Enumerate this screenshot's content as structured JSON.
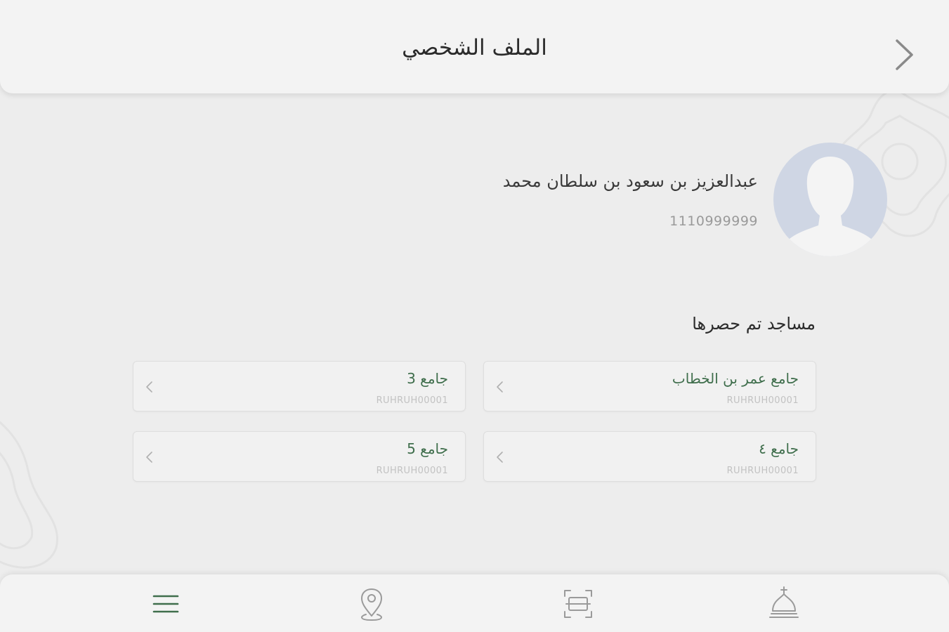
{
  "header": {
    "title": "الملف الشخصي",
    "back_icon": "chevron-right-icon"
  },
  "profile": {
    "name": "عبدالعزيز بن سعود بن سلطان محمد",
    "id_number": "1110999999",
    "avatar_icon": "user-silhouette-icon"
  },
  "mosques_section": {
    "title": "مساجد تم حصرها",
    "cards": [
      {
        "name": "جامع عمر بن الخطاب",
        "code": "RUHRUH00001"
      },
      {
        "name": "جامع 3",
        "code": "RUHRUH00001"
      },
      {
        "name": "جامع ٤",
        "code": "RUHRUH00001"
      },
      {
        "name": "جامع 5",
        "code": "RUHRUH00001"
      }
    ]
  },
  "bottom_nav": {
    "items": [
      {
        "icon": "mosque-icon"
      },
      {
        "icon": "scan-icon"
      },
      {
        "icon": "location-pin-icon"
      },
      {
        "icon": "menu-icon"
      }
    ]
  },
  "colors": {
    "accent_green": "#3f6e4c",
    "background": "#ededed",
    "avatar_bg": "#cfd6e4"
  }
}
